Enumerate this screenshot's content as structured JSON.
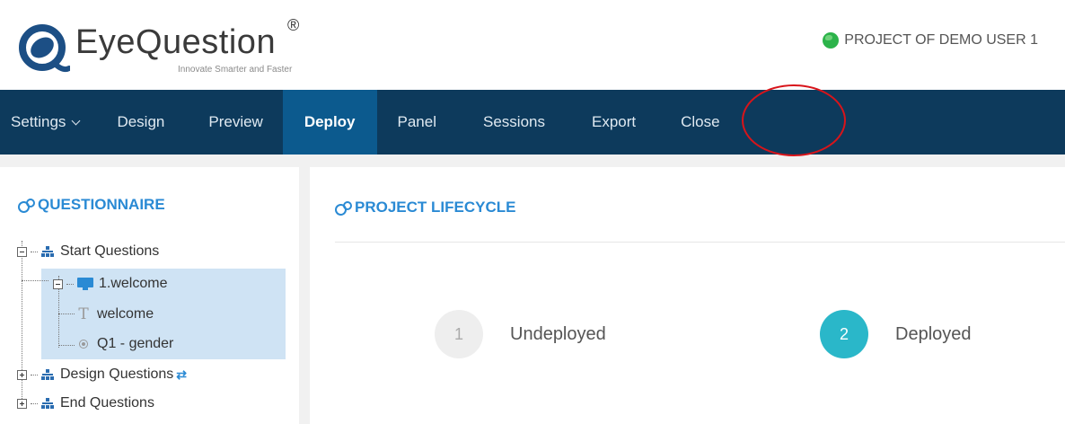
{
  "brand": {
    "name": "EyeQuestion",
    "registered": "®",
    "tagline": "Innovate Smarter and Faster"
  },
  "project": {
    "label": "PROJECT OF DEMO USER 1",
    "icon": "globe-icon"
  },
  "nav": {
    "items": [
      {
        "label": "Settings",
        "has_dropdown": true
      },
      {
        "label": "Design"
      },
      {
        "label": "Preview"
      },
      {
        "label": "Deploy",
        "active": true
      },
      {
        "label": "Panel"
      },
      {
        "label": "Sessions"
      },
      {
        "label": "Export"
      },
      {
        "label": "Close",
        "highlighted": true
      }
    ]
  },
  "questionnaire": {
    "title": "QUESTIONNAIRE",
    "tree": [
      {
        "label": "Start Questions",
        "icon": "sitemap-icon",
        "expanded": true
      },
      {
        "label": "1.welcome",
        "icon": "monitor-icon",
        "expanded": true,
        "selected": true
      },
      {
        "label": "welcome",
        "icon": "text-icon"
      },
      {
        "label": "Q1 - gender",
        "icon": "radio-icon"
      },
      {
        "label": "Design Questions",
        "icon": "sitemap-icon",
        "expanded": false,
        "badge_icon": "refresh-icon"
      },
      {
        "label": "End Questions",
        "icon": "sitemap-icon",
        "expanded": false
      }
    ]
  },
  "lifecycle": {
    "title": "PROJECT LIFECYCLE",
    "steps": [
      {
        "number": "1",
        "label": "Undeployed",
        "active": false
      },
      {
        "number": "2",
        "label": "Deployed",
        "active": true
      }
    ]
  },
  "colors": {
    "nav_bg": "#0d3a5c",
    "nav_active": "#0c5a8e",
    "accent": "#2a8ad4",
    "step_active": "#2ab7c9",
    "highlight": "#d8141a"
  }
}
